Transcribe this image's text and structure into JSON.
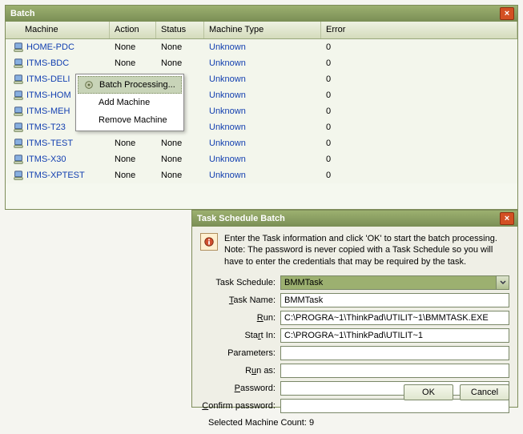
{
  "batch": {
    "title": "Batch",
    "columns": {
      "machine": "Machine",
      "action": "Action",
      "status": "Status",
      "type": "Machine Type",
      "error": "Error"
    },
    "rows": [
      {
        "machine": "HOME-PDC",
        "action": "None",
        "status": "None",
        "type": "Unknown",
        "error": "0"
      },
      {
        "machine": "ITMS-BDC",
        "action": "None",
        "status": "None",
        "type": "Unknown",
        "error": "0"
      },
      {
        "machine": "ITMS-DELI",
        "action": "",
        "status": "",
        "type": "Unknown",
        "error": "0"
      },
      {
        "machine": "ITMS-HOM",
        "action": "",
        "status": "",
        "type": "Unknown",
        "error": "0"
      },
      {
        "machine": "ITMS-MEH",
        "action": "",
        "status": "",
        "type": "Unknown",
        "error": "0"
      },
      {
        "machine": "ITMS-T23",
        "action": "",
        "status": "",
        "type": "Unknown",
        "error": "0"
      },
      {
        "machine": "ITMS-TEST",
        "action": "None",
        "status": "None",
        "type": "Unknown",
        "error": "0"
      },
      {
        "machine": "ITMS-X30",
        "action": "None",
        "status": "None",
        "type": "Unknown",
        "error": "0"
      },
      {
        "machine": "ITMS-XPTEST",
        "action": "None",
        "status": "None",
        "type": "Unknown",
        "error": "0"
      }
    ],
    "close_x": "×"
  },
  "context_menu": {
    "batch_processing": "Batch Processing...",
    "add_machine": "Add Machine",
    "remove_machine": "Remove Machine"
  },
  "dialog": {
    "title": "Task Schedule Batch",
    "info": "Enter the Task information and click 'OK' to start the batch processing. Note: The password is never copied with a Task Schedule so you will have to enter the credentials that may be required by the task.",
    "labels": {
      "task_schedule": "Task Schedule:",
      "task_name": "Task Name:",
      "run": "Run:",
      "start_in": "Start In:",
      "parameters": "Parameters:",
      "run_as": "Run as:",
      "password": "Password:",
      "confirm_password": "Confirm password:"
    },
    "fields": {
      "task_schedule": "BMMTask",
      "task_name": "BMMTask",
      "run": "C:\\PROGRA~1\\ThinkPad\\UTILIT~1\\BMMTASK.EXE",
      "start_in": "C:\\PROGRA~1\\ThinkPad\\UTILIT~1",
      "parameters": "",
      "run_as": "",
      "password": "",
      "confirm_password": ""
    },
    "selected_count": "Selected Machine Count: 9",
    "ok": "OK",
    "cancel": "Cancel",
    "close_x": "×"
  }
}
